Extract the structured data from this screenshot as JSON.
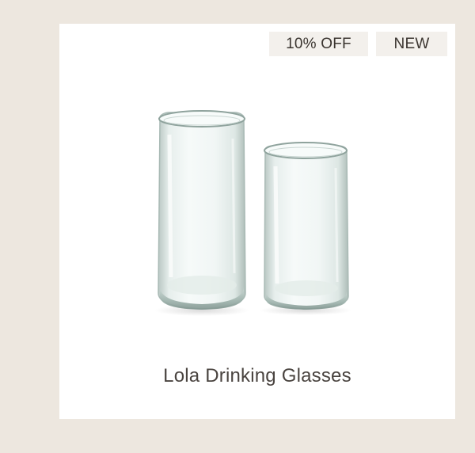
{
  "product": {
    "title": "Lola Drinking Glasses",
    "image_subject": "two clear recycled glass tumblers, one tall and one short"
  },
  "badges": {
    "discount": "10% OFF",
    "new": "NEW"
  },
  "colors": {
    "page_background": "#ede7df",
    "card_background": "#ffffff",
    "badge_background": "#f3f0ec",
    "text": "#4a4440"
  }
}
